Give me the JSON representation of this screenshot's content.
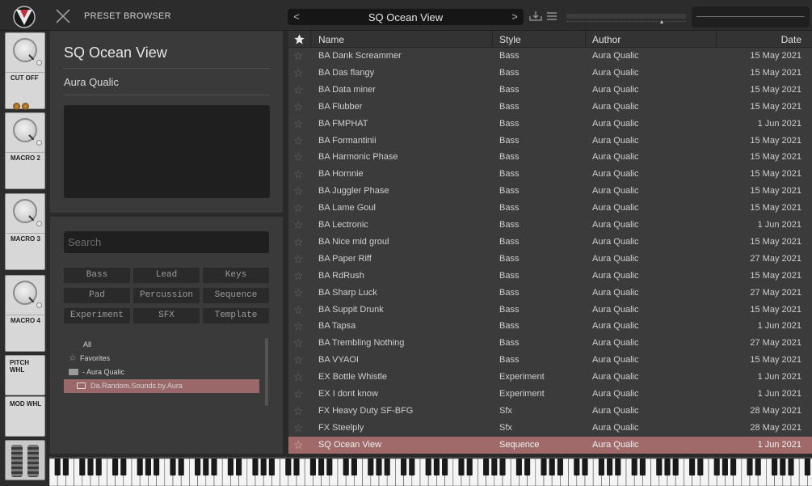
{
  "header": {
    "title": "PRESET BROWSER",
    "current_preset": "SQ Ocean View",
    "prev_arrow": "<",
    "next_arrow": ">"
  },
  "macros": [
    {
      "label": "CUT OFF"
    },
    {
      "label": "MACRO 2"
    },
    {
      "label": "MACRO 3"
    },
    {
      "label": "MACRO 4"
    }
  ],
  "wheels": {
    "pitch": "PITCH WHL",
    "mod": "MOD WHL"
  },
  "info": {
    "preset_name": "SQ Ocean View",
    "author": "Aura Qualic"
  },
  "search": {
    "placeholder": "Search"
  },
  "tags": [
    "Bass",
    "Lead",
    "Keys",
    "Pad",
    "Percussion",
    "Sequence",
    "Experiment",
    "SFX",
    "Template"
  ],
  "tree": {
    "all": "All",
    "favorites": "Favorites",
    "author_folder": "- Aura Qualic",
    "selected_folder": "Da.Random.Sounds.by.Aura"
  },
  "table": {
    "columns": {
      "name": "Name",
      "style": "Style",
      "author": "Author",
      "date": "Date"
    },
    "rows": [
      {
        "name": "BA Dank Screammer",
        "style": "Bass",
        "author": "Aura Qualic",
        "date": "15 May 2021"
      },
      {
        "name": "BA Das flangy",
        "style": "Bass",
        "author": "Aura Qualic",
        "date": "15 May 2021"
      },
      {
        "name": "BA Data miner",
        "style": "Bass",
        "author": "Aura Qualic",
        "date": "15 May 2021"
      },
      {
        "name": "BA Flubber",
        "style": "Bass",
        "author": "Aura Qualic",
        "date": "15 May 2021"
      },
      {
        "name": "BA FMPHAT",
        "style": "Bass",
        "author": "Aura Qualic",
        "date": "1 Jun 2021"
      },
      {
        "name": "BA Formantinii",
        "style": "Bass",
        "author": "Aura Qualic",
        "date": "15 May 2021"
      },
      {
        "name": "BA Harmonic Phase",
        "style": "Bass",
        "author": "Aura Qualic",
        "date": "15 May 2021"
      },
      {
        "name": "BA Hornnie",
        "style": "Bass",
        "author": "Aura Qualic",
        "date": "15 May 2021"
      },
      {
        "name": "BA Juggler Phase",
        "style": "Bass",
        "author": "Aura Qualic",
        "date": "15 May 2021"
      },
      {
        "name": "BA Lame Goul",
        "style": "Bass",
        "author": "Aura Qualic",
        "date": "15 May 2021"
      },
      {
        "name": "BA Lectronic",
        "style": "Bass",
        "author": "Aura Qualic",
        "date": "1 Jun 2021"
      },
      {
        "name": "BA Nice mid groul",
        "style": "Bass",
        "author": "Aura Qualic",
        "date": "15 May 2021"
      },
      {
        "name": "BA Paper Riff",
        "style": "Bass",
        "author": "Aura Qualic",
        "date": "27 May 2021"
      },
      {
        "name": "BA RdRush",
        "style": "Bass",
        "author": "Aura Qualic",
        "date": "15 May 2021"
      },
      {
        "name": "BA Sharp Luck",
        "style": "Bass",
        "author": "Aura Qualic",
        "date": "27 May 2021"
      },
      {
        "name": "BA Suppit Drunk",
        "style": "Bass",
        "author": "Aura Qualic",
        "date": "15 May 2021"
      },
      {
        "name": "BA Tapsa",
        "style": "Bass",
        "author": "Aura Qualic",
        "date": "1 Jun 2021"
      },
      {
        "name": "BA Trembling Nothing",
        "style": "Bass",
        "author": "Aura Qualic",
        "date": "27 May 2021"
      },
      {
        "name": "BA VYAOI",
        "style": "Bass",
        "author": "Aura Qualic",
        "date": "15 May 2021"
      },
      {
        "name": "EX Bottle Whistle",
        "style": "Experiment",
        "author": "Aura Qualic",
        "date": "1 Jun 2021"
      },
      {
        "name": "EX I dont know",
        "style": "Experiment",
        "author": "Aura Qualic",
        "date": "1 Jun 2021"
      },
      {
        "name": "FX Heavy Duty SF-BFG",
        "style": "Sfx",
        "author": "Aura Qualic",
        "date": "28 May 2021"
      },
      {
        "name": "FX Steelply",
        "style": "Sfx",
        "author": "Aura Qualic",
        "date": "28 May 2021"
      },
      {
        "name": "SQ Ocean View",
        "style": "Sequence",
        "author": "Aura Qualic",
        "date": "1 Jun 2021",
        "selected": true
      }
    ]
  },
  "colors": {
    "selection": "#a06a6a",
    "panel": "#3a3a3a",
    "background": "#2a2a2a"
  },
  "icons": [
    "vital-logo-icon",
    "close-icon",
    "save-icon",
    "menu-icon",
    "star-icon",
    "folder-icon"
  ]
}
